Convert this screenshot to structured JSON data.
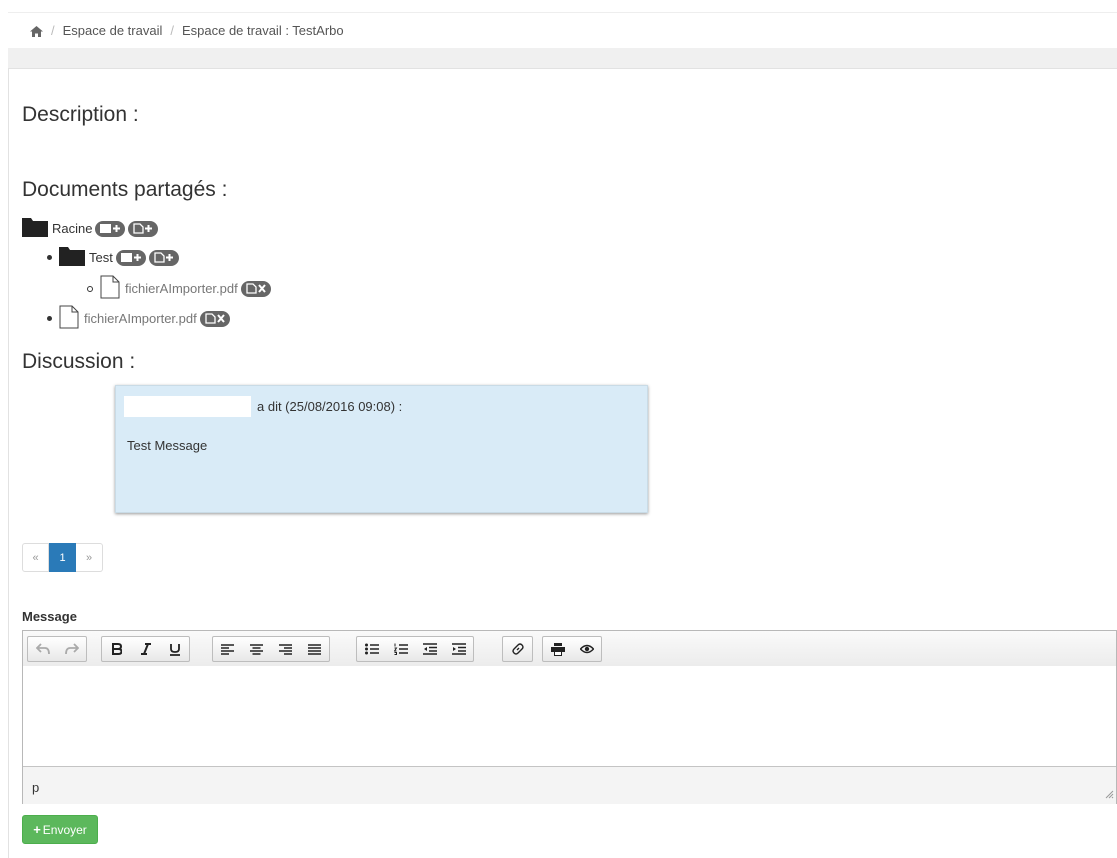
{
  "breadcrumb": {
    "home_icon": "home-icon",
    "separator": "/",
    "items": [
      "Espace de travail",
      "Espace de travail : TestArbo"
    ]
  },
  "sections": {
    "description_title": "Description :",
    "documents_title": "Documents partagés :",
    "discussion_title": "Discussion :"
  },
  "tree": {
    "root": "Racine",
    "folder_test": "Test",
    "file_in_test": "fichierAImporter.pdf",
    "file_in_root": "fichierAImporter.pdf"
  },
  "discussion": {
    "meta": "a dit (25/08/2016 09:08) :",
    "text": "Test Message"
  },
  "pagination": {
    "prev": "«",
    "current": "1",
    "next": "»"
  },
  "form": {
    "label": "Message",
    "status_path": "p",
    "send_label": "Envoyer"
  },
  "colors": {
    "accent": "#2a7ab8",
    "message_bg": "#d9ebf7",
    "send_button": "#5cb85c",
    "pill": "#666666"
  }
}
